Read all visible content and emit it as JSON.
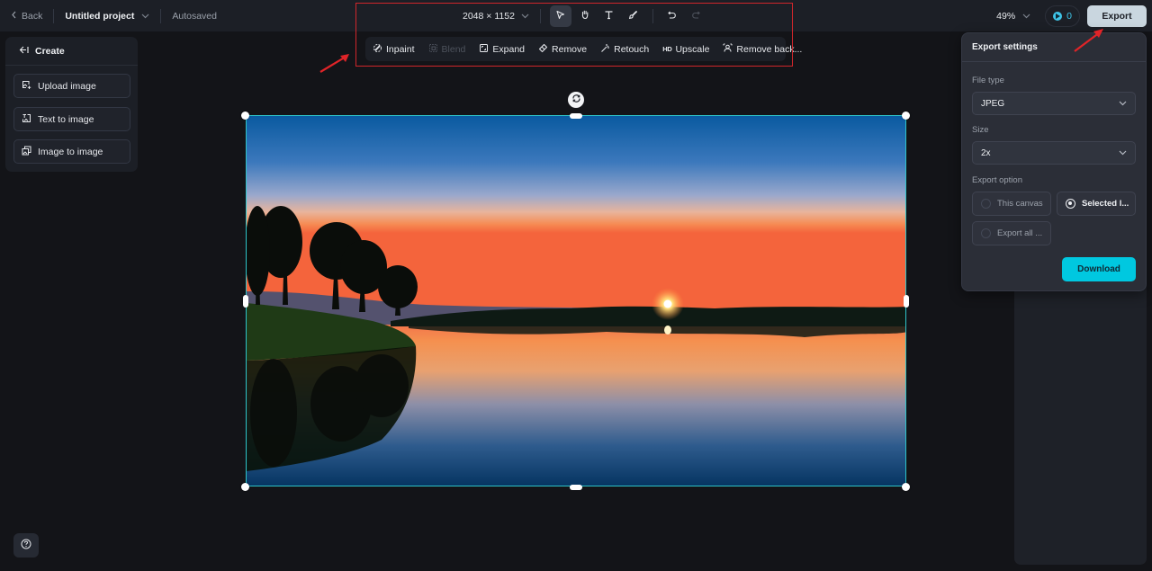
{
  "topbar": {
    "back_label": "Back",
    "project_name": "Untitled project",
    "save_status": "Autosaved",
    "canvas_dimensions": "2048 × 1152",
    "tools": [
      {
        "name": "select",
        "icon": "cursor-arrow-icon",
        "active": true
      },
      {
        "name": "hand",
        "icon": "hand-icon",
        "active": false
      },
      {
        "name": "text",
        "icon": "text-icon",
        "active": false
      },
      {
        "name": "brush",
        "icon": "brush-icon",
        "active": false
      }
    ],
    "undo_icon": "undo-icon",
    "redo_icon": "redo-icon",
    "zoom_level": "49%",
    "credits": "0",
    "export_label": "Export"
  },
  "edit_toolbar": {
    "items": [
      {
        "label": "Inpaint",
        "icon": "inpaint-icon",
        "enabled": true
      },
      {
        "label": "Blend",
        "icon": "blend-icon",
        "enabled": false
      },
      {
        "label": "Expand",
        "icon": "expand-icon",
        "enabled": true
      },
      {
        "label": "Remove",
        "icon": "eraser-icon",
        "enabled": true
      },
      {
        "label": "Retouch",
        "icon": "magic-wand-icon",
        "enabled": true
      },
      {
        "label": "Upscale",
        "icon": "hd-icon",
        "icon_text": "HD",
        "enabled": true
      },
      {
        "label": "Remove back...",
        "icon": "remove-background-icon",
        "enabled": true
      }
    ]
  },
  "left_panel": {
    "header": "Create",
    "items": [
      {
        "label": "Upload image",
        "icon": "upload-image-icon"
      },
      {
        "label": "Text to image",
        "icon": "text-to-image-icon"
      },
      {
        "label": "Image to image",
        "icon": "image-to-image-icon"
      }
    ]
  },
  "export_settings": {
    "title": "Export settings",
    "file_type_label": "File type",
    "file_type_value": "JPEG",
    "size_label": "Size",
    "size_value": "2x",
    "export_option_label": "Export option",
    "options": [
      {
        "label": "This canvas",
        "selected": false
      },
      {
        "label": "Selected l...",
        "selected": true
      },
      {
        "label": "Export all ...",
        "selected": false
      }
    ],
    "download_label": "Download"
  },
  "colors": {
    "accent": "#00c8e0",
    "selection": "#2ec4c9",
    "annotation": "#d0262b",
    "background": "#131418",
    "panel": "#1c1f26"
  }
}
